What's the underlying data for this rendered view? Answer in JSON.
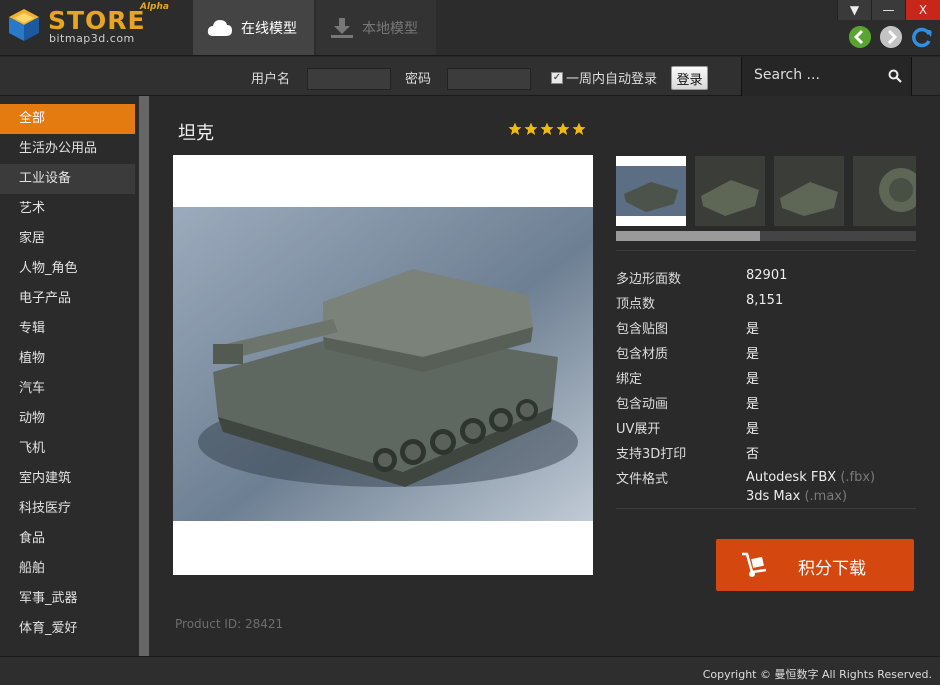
{
  "app": {
    "logo_word": "STORE",
    "logo_badge": "Alpha",
    "logo_sub": "bitmap3d.com"
  },
  "top_tabs": [
    {
      "label": "在线模型",
      "icon": "cloud-icon",
      "active": true
    },
    {
      "label": "本地模型",
      "icon": "download-icon",
      "active": false
    }
  ],
  "window_controls": {
    "menu": "▼",
    "minimize": "—",
    "close": "X"
  },
  "login": {
    "username_label": "用户名",
    "password_label": "密码",
    "remember_label": "一周内自动登录",
    "remember_checked": true,
    "login_button": "登录"
  },
  "search": {
    "placeholder": "Search ..."
  },
  "sidebar": {
    "items": [
      {
        "label": "全部",
        "state": "active"
      },
      {
        "label": "生活办公用品",
        "state": ""
      },
      {
        "label": "工业设备",
        "state": "hover"
      },
      {
        "label": "艺术",
        "state": ""
      },
      {
        "label": "家居",
        "state": ""
      },
      {
        "label": "人物_角色",
        "state": ""
      },
      {
        "label": "电子产品",
        "state": ""
      },
      {
        "label": "专辑",
        "state": ""
      },
      {
        "label": "植物",
        "state": ""
      },
      {
        "label": "汽车",
        "state": ""
      },
      {
        "label": "动物",
        "state": ""
      },
      {
        "label": "飞机",
        "state": ""
      },
      {
        "label": "室内建筑",
        "state": ""
      },
      {
        "label": "科技医疗",
        "state": ""
      },
      {
        "label": "食品",
        "state": ""
      },
      {
        "label": "船舶",
        "state": ""
      },
      {
        "label": "军事_武器",
        "state": ""
      },
      {
        "label": "体育_爱好",
        "state": ""
      }
    ]
  },
  "model": {
    "title": "坦克",
    "rating": 5,
    "rating_max": 5,
    "specs": [
      {
        "key": "多边形面数",
        "value": "82901"
      },
      {
        "key": "顶点数",
        "value": "8,151"
      },
      {
        "key": "包含贴图",
        "value": "是"
      },
      {
        "key": "包含材质",
        "value": "是"
      },
      {
        "key": "绑定",
        "value": "是"
      },
      {
        "key": "包含动画",
        "value": "是"
      },
      {
        "key": "UV展开",
        "value": "是"
      },
      {
        "key": "支持3D打印",
        "value": "否"
      }
    ],
    "format_key": "文件格式",
    "formats": [
      {
        "name": "Autodesk FBX",
        "ext": "(.fbx)"
      },
      {
        "name": "3ds Max",
        "ext": "(.max)"
      }
    ],
    "download_label": "积分下载",
    "product_id": "Product ID: 28421"
  },
  "thumbnails": {
    "count_visible": 4,
    "scroll_fraction": 0.48
  },
  "footer": {
    "copyright": "Copyright © 曼恒数字 All Rights Reserved."
  },
  "colors": {
    "accent": "#e37b10",
    "download": "#d4480f",
    "close": "#c8261b",
    "star": "#f2b90f"
  }
}
